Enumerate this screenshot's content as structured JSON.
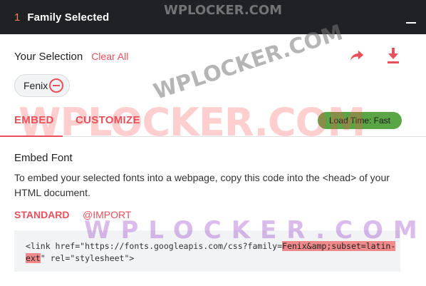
{
  "header": {
    "count": "1",
    "title": "Family Selected"
  },
  "selection": {
    "label": "Your Selection",
    "clear_label": "Clear All",
    "chips": [
      {
        "name": "Fenix"
      }
    ]
  },
  "tabs": [
    {
      "label": "EMBED",
      "active": true
    },
    {
      "label": "CUSTOMIZE",
      "active": false
    }
  ],
  "load_time": "Load Time: Fast",
  "embed": {
    "title": "Embed Font",
    "description": "To embed your selected fonts into a webpage, copy this code into the <head> of your HTML document."
  },
  "subtabs": [
    {
      "label": "STANDARD",
      "active": true
    },
    {
      "label": "@IMPORT",
      "active": false
    }
  ],
  "code": {
    "prefix": "<link href=\"https://fonts.googleapis.com/css?family=",
    "highlight": "Fenix&amp;subset=latin-ext",
    "suffix": "\" rel=\"stylesheet\">"
  },
  "watermarks": {
    "red": "WPLOCKER.COM",
    "gray_top": "WPLOCKER.COM",
    "gray_arc": "WPLOCKER.COM",
    "purple": "WPLOCKER.COM"
  },
  "colors": {
    "accent": "#e8505b",
    "header_bg": "#202124",
    "badge_bg": "#5aa545",
    "code_bg": "#f1f3f4",
    "code_highlight": "#f08a8a"
  },
  "icons": {
    "share": "share-arrow-icon",
    "download": "download-icon",
    "remove": "remove-circle-icon",
    "minimize": "minimize-icon"
  }
}
